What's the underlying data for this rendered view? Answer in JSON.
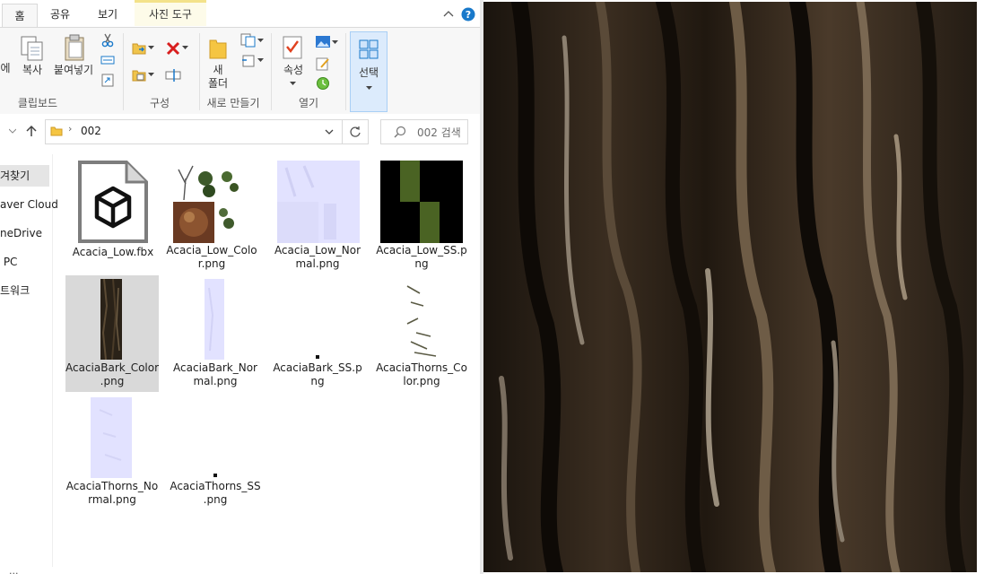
{
  "ribbon": {
    "tabs": [
      {
        "label": "홈",
        "active": true
      },
      {
        "label": "공유"
      },
      {
        "label": "보기"
      },
      {
        "label": "사진 도구",
        "context": true
      }
    ],
    "buttons": {
      "pin_partial": "에",
      "copy": "복사",
      "paste": "붙여넣기",
      "new_folder_line1": "새",
      "new_folder_line2": "폴더",
      "properties": "속성",
      "select": "선택"
    },
    "groups": {
      "clipboard": "클립보드",
      "organize": "구성",
      "new": "새로 만들기",
      "open": "열기"
    }
  },
  "address": {
    "path_folder": "002",
    "search_placeholder": "002 검색"
  },
  "nav": [
    {
      "label": "겨찾기",
      "selected": true
    },
    {
      "label": "aver Cloud"
    },
    {
      "label": "neDrive"
    },
    {
      "label": " PC"
    },
    {
      "label": "트워크"
    }
  ],
  "files": [
    {
      "line1": "Acacia_Low.fbx",
      "line2": "",
      "thumb": "fbx-icon"
    },
    {
      "line1": "Acacia_Low_Colo",
      "line2": "r.png",
      "thumb": "color-atlas"
    },
    {
      "line1": "Acacia_Low_Nor",
      "line2": "mal.png",
      "thumb": "normal-map"
    },
    {
      "line1": "Acacia_Low_SS.p",
      "line2": "ng",
      "thumb": "ss-map"
    },
    {
      "line1": "AcaciaBark_Color",
      "line2": ".png",
      "thumb": "bark-strip",
      "selected": true
    },
    {
      "line1": "AcaciaBark_Nor",
      "line2": "mal.png",
      "thumb": "normal-strip"
    },
    {
      "line1": "AcaciaBark_SS.p",
      "line2": "ng",
      "thumb": "dot"
    },
    {
      "line1": "AcaciaThorns_Co",
      "line2": "lor.png",
      "thumb": "thorns"
    },
    {
      "line1": "AcaciaThorns_No",
      "line2": "rmal.png",
      "thumb": "normal-tall"
    },
    {
      "line1": "AcaciaThorns_SS",
      "line2": ".png",
      "thumb": "dot"
    }
  ],
  "status_text": "...",
  "colors": {
    "accent": "#1979ca",
    "selection": "#d9d9d9",
    "normal_map": "#e2e2ff",
    "ss_green": "#4a6323",
    "context_tab": "#f3e28a",
    "bark_dark": "#241d15"
  }
}
